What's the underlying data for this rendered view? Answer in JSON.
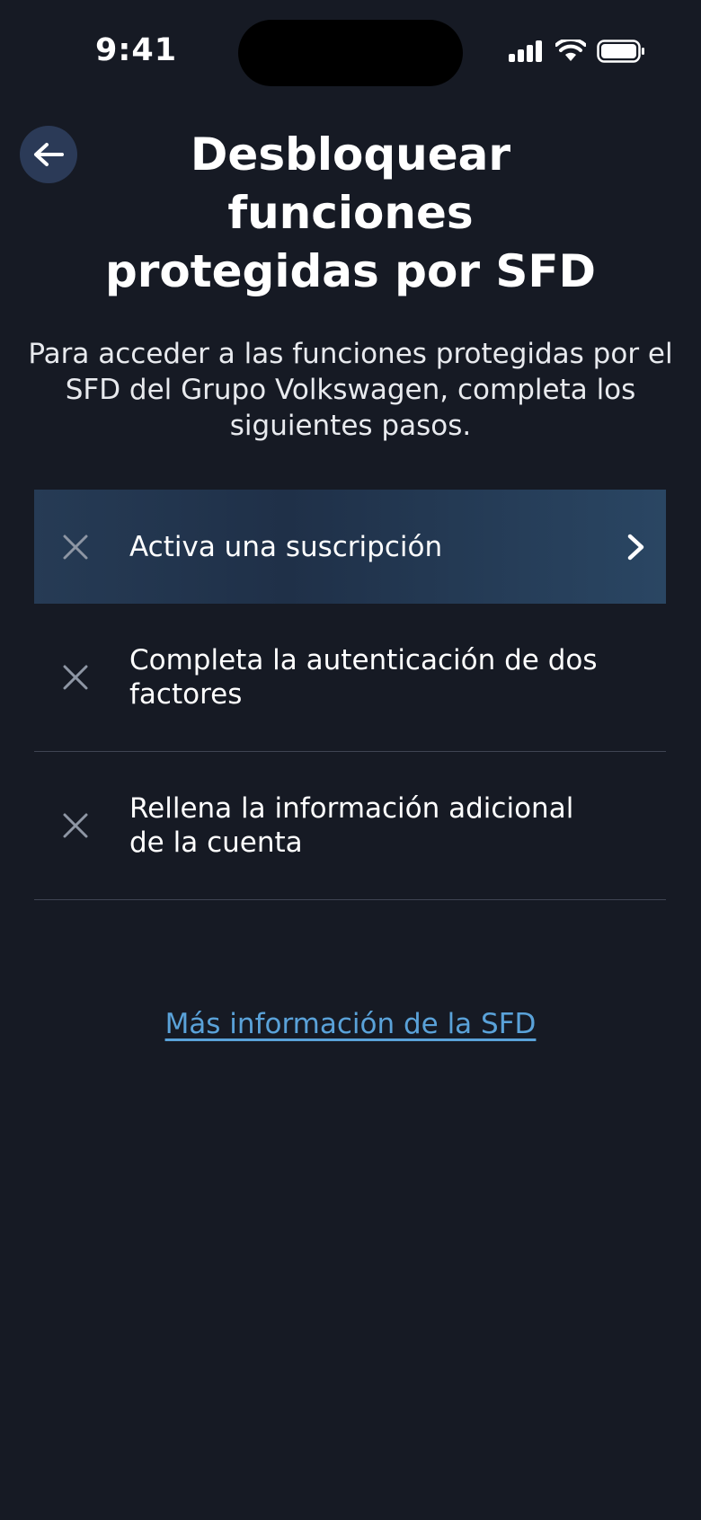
{
  "status_bar": {
    "time": "9:41"
  },
  "header": {
    "back_icon": "arrow-left-icon",
    "title": "Desbloquear\nfunciones\nprotegidas por SFD"
  },
  "intro": {
    "text": "Para acceder a las funciones protegidas por el SFD del Grupo Volkswagen, completa los siguientes pasos."
  },
  "steps": [
    {
      "label": "Activa una suscripción",
      "status": "incomplete",
      "active": true
    },
    {
      "label": "Completa la autenticación de dos factores",
      "status": "incomplete",
      "active": false
    },
    {
      "label": "Rellena la información adicional de la cuenta",
      "status": "incomplete",
      "active": false
    }
  ],
  "footer": {
    "more_info_link": "Más información de la SFD"
  },
  "colors": {
    "background": "#161a24",
    "active_row": "#263b55",
    "link": "#5aa2d9",
    "x_icon": "#8e96a4"
  }
}
